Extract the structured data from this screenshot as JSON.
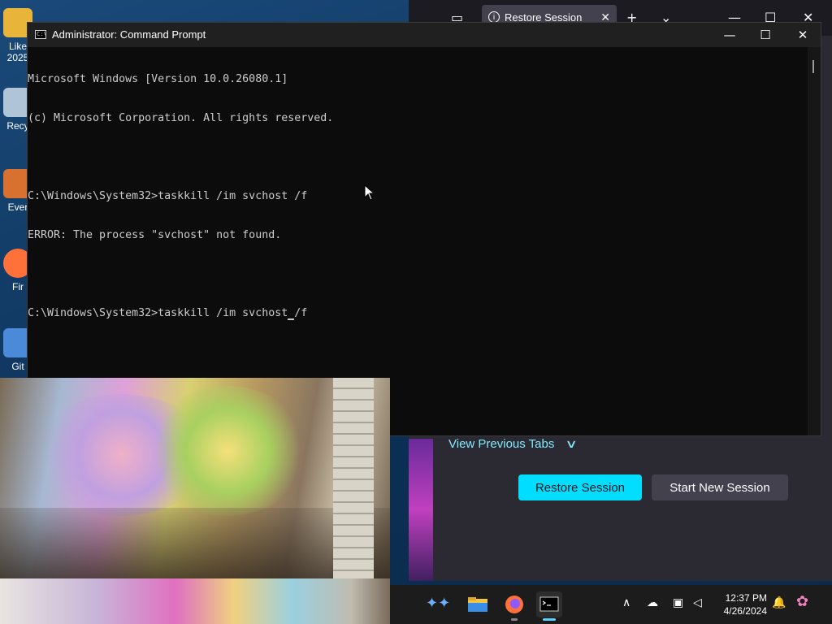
{
  "desktop": {
    "icons": [
      {
        "label": "Like\n2025",
        "color": "#e8b43a"
      },
      {
        "label": "Recy",
        "color": "#b0c4d8"
      },
      {
        "label": "Ever",
        "color": "#d87030"
      },
      {
        "label": "Fir",
        "color": "#ff7139"
      },
      {
        "label": "Git",
        "color": "#4a8ad8"
      }
    ]
  },
  "firefox": {
    "tab_label": "Restore Session",
    "view_previous_tabs": "View Previous Tabs",
    "restore_button": "Restore Session",
    "new_session_button": "Start New Session"
  },
  "cmd": {
    "title": "Administrator: Command Prompt",
    "lines": [
      "Microsoft Windows [Version 10.0.26080.1]",
      "(c) Microsoft Corporation. All rights reserved.",
      "",
      "C:\\Windows\\System32>taskkill /im svchost /f",
      "ERROR: The process \"svchost\" not found.",
      "",
      "C:\\Windows\\System32>taskkill /im svchost"
    ],
    "current_input_suffix": "/f"
  },
  "taskbar": {
    "apps": [
      {
        "name": "copilot-sparkle-icon",
        "color": "#6ab0ff"
      },
      {
        "name": "file-explorer-icon",
        "color": "#f5c542"
      },
      {
        "name": "firefox-icon",
        "color": "#ff7139"
      },
      {
        "name": "terminal-icon",
        "color": "#2d2d2d"
      }
    ],
    "time": "12:37 PM",
    "date": "4/26/2024"
  }
}
